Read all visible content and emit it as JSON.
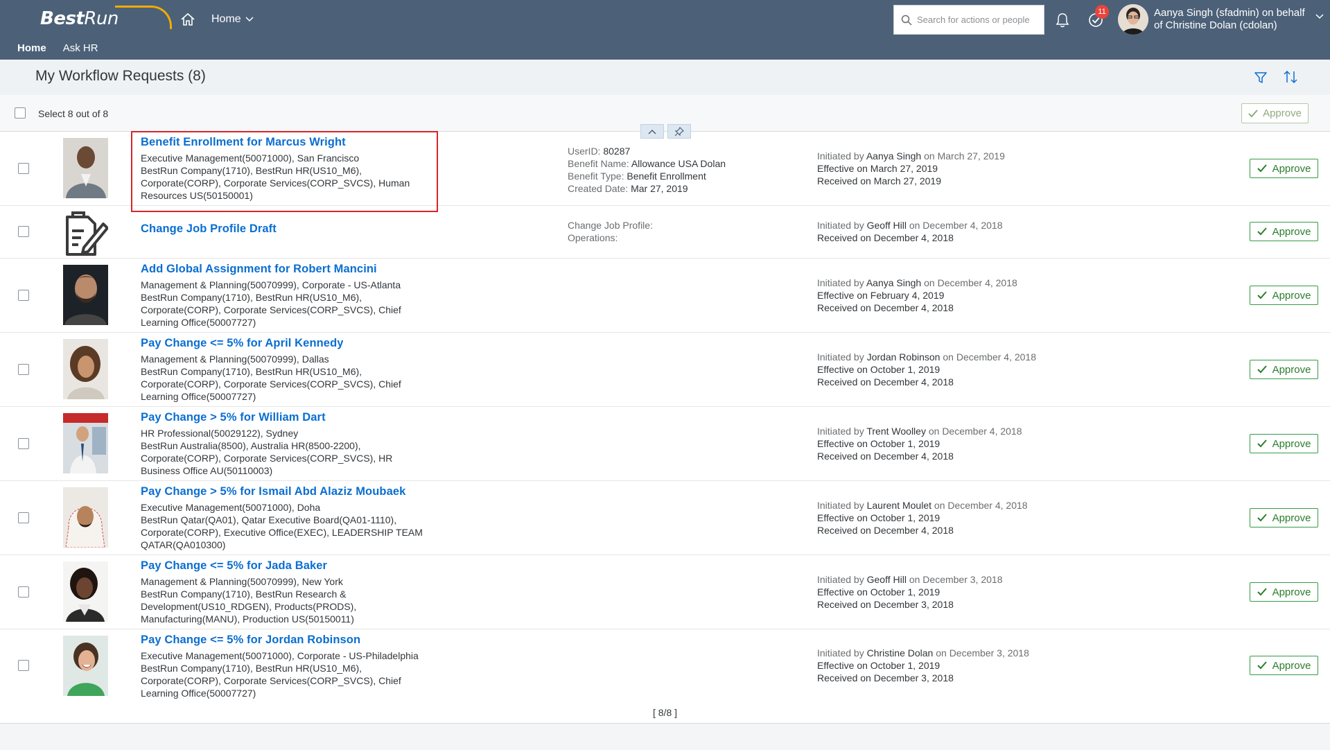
{
  "brand": {
    "best": "Best",
    "run": "Run"
  },
  "shell": {
    "home_menu_label": "Home",
    "search_placeholder": "Search for actions or people",
    "task_badge": "11",
    "user_line1": "Aanya Singh (sfadmin) on behalf",
    "user_line2": "of Christine Dolan (cdolan)",
    "subnav": [
      "Home",
      "Ask HR"
    ]
  },
  "page": {
    "title": "My Workflow Requests (8)",
    "select_label": "Select 8 out of 8",
    "approve_all_label": "Approve",
    "footer": "[ 8/8 ]"
  },
  "colors": {
    "shell_bg": "#4c6178",
    "link": "#0a6ed1",
    "accept": "#2b7d2b",
    "highlight": "#d6242b"
  },
  "requests": [
    {
      "title": "Benefit Enrollment for Marcus Wright",
      "desc": [
        "Executive Management(50071000), San Francisco",
        "BestRun Company(1710), BestRun HR(US10_M6),",
        "Corporate(CORP), Corporate Services(CORP_SVCS), Human",
        "Resources US(50150001)"
      ],
      "mid": [
        [
          "UserID: ",
          "80287"
        ],
        [
          "Benefit Name: ",
          "Allowance USA Dolan"
        ],
        [
          "Benefit Type: ",
          "Benefit Enrollment"
        ],
        [
          "Created Date: ",
          "Mar 27, 2019"
        ]
      ],
      "initiated_by": "Aanya Singh",
      "initiated_on": "March 27, 2019",
      "effective": "Effective on March 27, 2019",
      "received": "Received on March 27, 2019",
      "approve": "Approve",
      "photo": "portrait-bald-man"
    },
    {
      "title": "Change Job Profile Draft",
      "desc": [],
      "mid": [
        [
          "Change Job Profile:",
          ""
        ],
        [
          "Operations:",
          ""
        ]
      ],
      "initiated_by": "Geoff Hill",
      "initiated_on": "December 4, 2018",
      "effective": "",
      "received": "Received on December 4, 2018",
      "approve": "Approve",
      "photo": "document-edit-icon"
    },
    {
      "title": "Add Global Assignment for Robert Mancini",
      "desc": [
        "Management & Planning(50070999), Corporate - US-Atlanta",
        "BestRun Company(1710), BestRun HR(US10_M6),",
        "Corporate(CORP), Corporate Services(CORP_SVCS), Chief",
        "Learning Office(50007727)"
      ],
      "mid": [],
      "initiated_by": "Aanya Singh",
      "initiated_on": "December 4, 2018",
      "effective": "Effective on February 4, 2019",
      "received": "Received on December 4, 2018",
      "approve": "Approve",
      "photo": "portrait-bearded-man"
    },
    {
      "title": "Pay Change <= 5% for April Kennedy",
      "desc": [
        "Management & Planning(50070999), Dallas",
        "BestRun Company(1710), BestRun HR(US10_M6),",
        "Corporate(CORP), Corporate Services(CORP_SVCS), Chief",
        "Learning Office(50007727)"
      ],
      "mid": [],
      "initiated_by": "Jordan Robinson",
      "initiated_on": "December 4, 2018",
      "effective": "Effective on October 1, 2019",
      "received": "Received on December 4, 2018",
      "approve": "Approve",
      "photo": "portrait-curly-woman"
    },
    {
      "title": "Pay Change > 5% for William Dart",
      "desc": [
        "HR Professional(50029122), Sydney",
        "BestRun Australia(8500), Australia HR(8500-2200),",
        "Corporate(CORP), Corporate Services(CORP_SVCS), HR",
        "Business Office AU(50110003)"
      ],
      "mid": [],
      "initiated_by": "Trent Woolley",
      "initiated_on": "December 4, 2018",
      "effective": "Effective on October 1, 2019",
      "received": "Received on December 4, 2018",
      "approve": "Approve",
      "photo": "portrait-man-office"
    },
    {
      "title": "Pay Change > 5% for Ismail Abd Alaziz Moubaek",
      "desc": [
        "Executive Management(50071000), Doha",
        "BestRun Qatar(QA01), Qatar Executive Board(QA01-1110),",
        "Corporate(CORP), Executive Office(EXEC), LEADERSHIP TEAM",
        "QATAR(QA010300)"
      ],
      "mid": [],
      "initiated_by": "Laurent Moulet",
      "initiated_on": "December 4, 2018",
      "effective": "Effective on October 1, 2019",
      "received": "Received on December 4, 2018",
      "approve": "Approve",
      "photo": "portrait-man-keffiyeh"
    },
    {
      "title": "Pay Change <= 5% for Jada Baker",
      "desc": [
        "Management & Planning(50070999), New York",
        "BestRun Company(1710), BestRun Research &",
        "Development(US10_RDGEN), Products(PRODS),",
        "Manufacturing(MANU), Production US(50150011)"
      ],
      "mid": [],
      "initiated_by": "Geoff Hill",
      "initiated_on": "December 3, 2018",
      "effective": "Effective on October 1, 2019",
      "received": "Received on December 3, 2018",
      "approve": "Approve",
      "photo": "portrait-woman-dark"
    },
    {
      "title": "Pay Change <= 5% for Jordan Robinson",
      "desc": [
        "Executive Management(50071000), Corporate - US-Philadelphia",
        "BestRun Company(1710), BestRun HR(US10_M6),",
        "Corporate(CORP), Corporate Services(CORP_SVCS), Chief",
        "Learning Office(50007727)"
      ],
      "mid": [],
      "initiated_by": "Christine Dolan",
      "initiated_on": "December 3, 2018",
      "effective": "Effective on October 1, 2019",
      "received": "Received on December 3, 2018",
      "approve": "Approve",
      "photo": "portrait-woman-smiling"
    }
  ]
}
